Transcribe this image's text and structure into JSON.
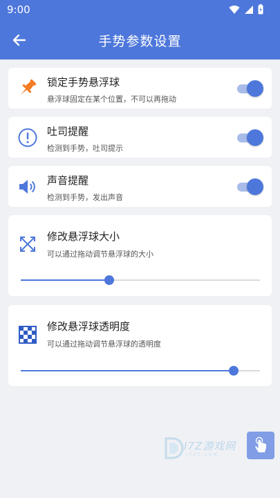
{
  "status": {
    "time": "9:00"
  },
  "header": {
    "title": "手势参数设置",
    "back_icon": "arrow-left-icon"
  },
  "settings": [
    {
      "icon": "pushpin-icon",
      "title": "锁定手势悬浮球",
      "subtitle": "悬浮球固定在某个位置，不可以再拖动",
      "enabled": true
    },
    {
      "icon": "alert-circle-icon",
      "title": "吐司提醒",
      "subtitle": "检测到手势，吐司提示",
      "enabled": true
    },
    {
      "icon": "speaker-icon",
      "title": "声音提醒",
      "subtitle": "检测到手势，发出声音",
      "enabled": true
    }
  ],
  "sliders": [
    {
      "icon": "resize-arrows-icon",
      "title": "修改悬浮球大小",
      "subtitle": "可以通过拖动调节悬浮球的大小",
      "value_fraction": 0.37
    },
    {
      "icon": "checkerboard-icon",
      "title": "修改悬浮球透明度",
      "subtitle": "可以通过拖动调节悬浮球的透明度",
      "value_fraction": 0.89
    }
  ],
  "watermark": {
    "text": "I7Z游戏网",
    "subtext": "ITZZ·COM"
  },
  "colors": {
    "primary": "#4d77db",
    "track_on": "#a9bce9",
    "pin_orange": "#f47a20",
    "icon_blue": "#4d77db"
  }
}
